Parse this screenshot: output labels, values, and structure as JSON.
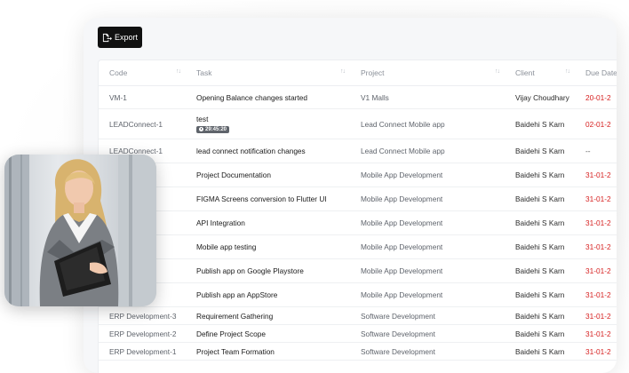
{
  "toolbar": {
    "export_label": "Export",
    "export_icon": "export-icon"
  },
  "table": {
    "headers": [
      "Code",
      "Task",
      "Project",
      "Client",
      "Due Date"
    ],
    "rows": [
      {
        "code": "VM-1",
        "task": "Opening Balance changes started",
        "project": "V1 Malls",
        "client": "Vijay Choudhary",
        "due": "20-01-2",
        "due_state": "overdue"
      },
      {
        "code": "LEADConnect-1",
        "task": "test",
        "timer": "29:45:20",
        "project": "Lead Connect Mobile app",
        "client": "Baidehi S Karn",
        "due": "02-01-2",
        "due_state": "overdue"
      },
      {
        "code": "LEADConnect-1",
        "task": "lead connect notification changes",
        "project": "Lead Connect Mobile app",
        "client": "Baidehi S Karn",
        "due": "--",
        "due_state": "none"
      },
      {
        "code": "",
        "task": "Project Documentation",
        "project": "Mobile App Development",
        "client": "Baidehi S Karn",
        "due": "31-01-2",
        "due_state": "overdue"
      },
      {
        "code": "",
        "task": "FIGMA Screens conversion to Flutter UI",
        "project": "Mobile App Development",
        "client": "Baidehi S Karn",
        "due": "31-01-2",
        "due_state": "overdue"
      },
      {
        "code": "",
        "task": "API Integration",
        "project": "Mobile App Development",
        "client": "Baidehi S Karn",
        "due": "31-01-2",
        "due_state": "overdue"
      },
      {
        "code": "",
        "task": "Mobile app testing",
        "project": "Mobile App Development",
        "client": "Baidehi S Karn",
        "due": "31-01-2",
        "due_state": "overdue"
      },
      {
        "code": "",
        "task": "Publish app on Google Playstore",
        "project": "Mobile App Development",
        "client": "Baidehi S Karn",
        "due": "31-01-2",
        "due_state": "overdue"
      },
      {
        "code": "",
        "task": "Publish app an AppStore",
        "project": "Mobile App Development",
        "client": "Baidehi S Karn",
        "due": "31-01-2",
        "due_state": "overdue"
      },
      {
        "code": "ERP Development-3",
        "task": "Requirement Gathering",
        "project": "Software Development",
        "client": "Baidehi S Karn",
        "due": "31-01-2",
        "due_state": "overdue"
      },
      {
        "code": "ERP Development-2",
        "task": "Define Project Scope",
        "project": "Software Development",
        "client": "Baidehi S Karn",
        "due": "31-01-2",
        "due_state": "overdue"
      },
      {
        "code": "ERP Development-1",
        "task": "Project Team Formation",
        "project": "Software Development",
        "client": "Baidehi S Karn",
        "due": "31-01-2",
        "due_state": "overdue"
      }
    ]
  },
  "photo": {
    "subject": "woman-with-clipboard-photo"
  },
  "colors": {
    "overdue": "#d61f1f",
    "button_bg": "#111111",
    "timer_bg": "#5f646b"
  }
}
